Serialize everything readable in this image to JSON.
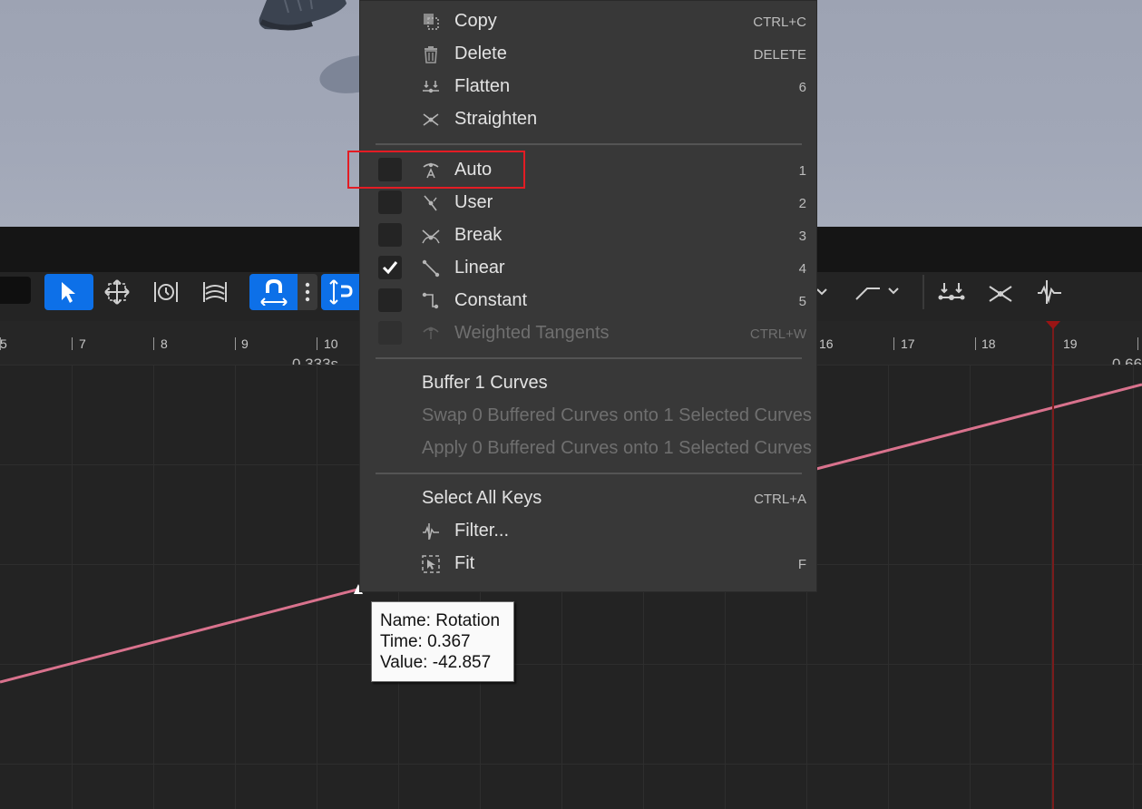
{
  "menu": {
    "items": [
      {
        "label": "Copy",
        "shortcut": "CTRL+C",
        "icon": "copy-icon"
      },
      {
        "label": "Delete",
        "shortcut": "DELETE",
        "icon": "trash-icon"
      },
      {
        "label": "Flatten",
        "shortcut": "6",
        "icon": "flatten-icon"
      },
      {
        "label": "Straighten",
        "shortcut": "",
        "icon": "straighten-icon"
      }
    ],
    "tangents": [
      {
        "label": "Auto",
        "shortcut": "1",
        "icon": "auto-tangent-icon",
        "checked": false
      },
      {
        "label": "User",
        "shortcut": "2",
        "icon": "user-tangent-icon",
        "checked": false
      },
      {
        "label": "Break",
        "shortcut": "3",
        "icon": "break-tangent-icon",
        "checked": false
      },
      {
        "label": "Linear",
        "shortcut": "4",
        "icon": "linear-tangent-icon",
        "checked": true
      },
      {
        "label": "Constant",
        "shortcut": "5",
        "icon": "constant-tangent-icon",
        "checked": false
      },
      {
        "label": "Weighted Tangents",
        "shortcut": "CTRL+W",
        "icon": "weighted-tangent-icon",
        "checked": false,
        "disabled": true
      }
    ],
    "buffer": [
      {
        "label": "Buffer 1 Curves"
      },
      {
        "label": "Swap 0 Buffered Curves onto 1 Selected Curves",
        "disabled": true
      },
      {
        "label": "Apply 0 Buffered Curves onto 1 Selected Curves",
        "disabled": true
      }
    ],
    "select_all": {
      "label": "Select All Keys",
      "shortcut": "CTRL+A"
    },
    "filter": {
      "label": "Filter...",
      "icon": "filter-icon"
    },
    "fit": {
      "label": "Fit",
      "shortcut": "F",
      "icon": "fit-icon"
    }
  },
  "ruler": {
    "ticks": [
      "5",
      "7",
      "8",
      "9",
      "10",
      "16",
      "17",
      "18",
      "19"
    ],
    "time_left": "0.333s",
    "time_right": "0.66"
  },
  "tooltip": {
    "name": "Name: Rotation",
    "time": "Time: 0.367",
    "value": "Value: -42.857"
  },
  "colors": {
    "accent": "#0d70e8",
    "curve": "#d9728d",
    "highlight": "#e31c24"
  }
}
